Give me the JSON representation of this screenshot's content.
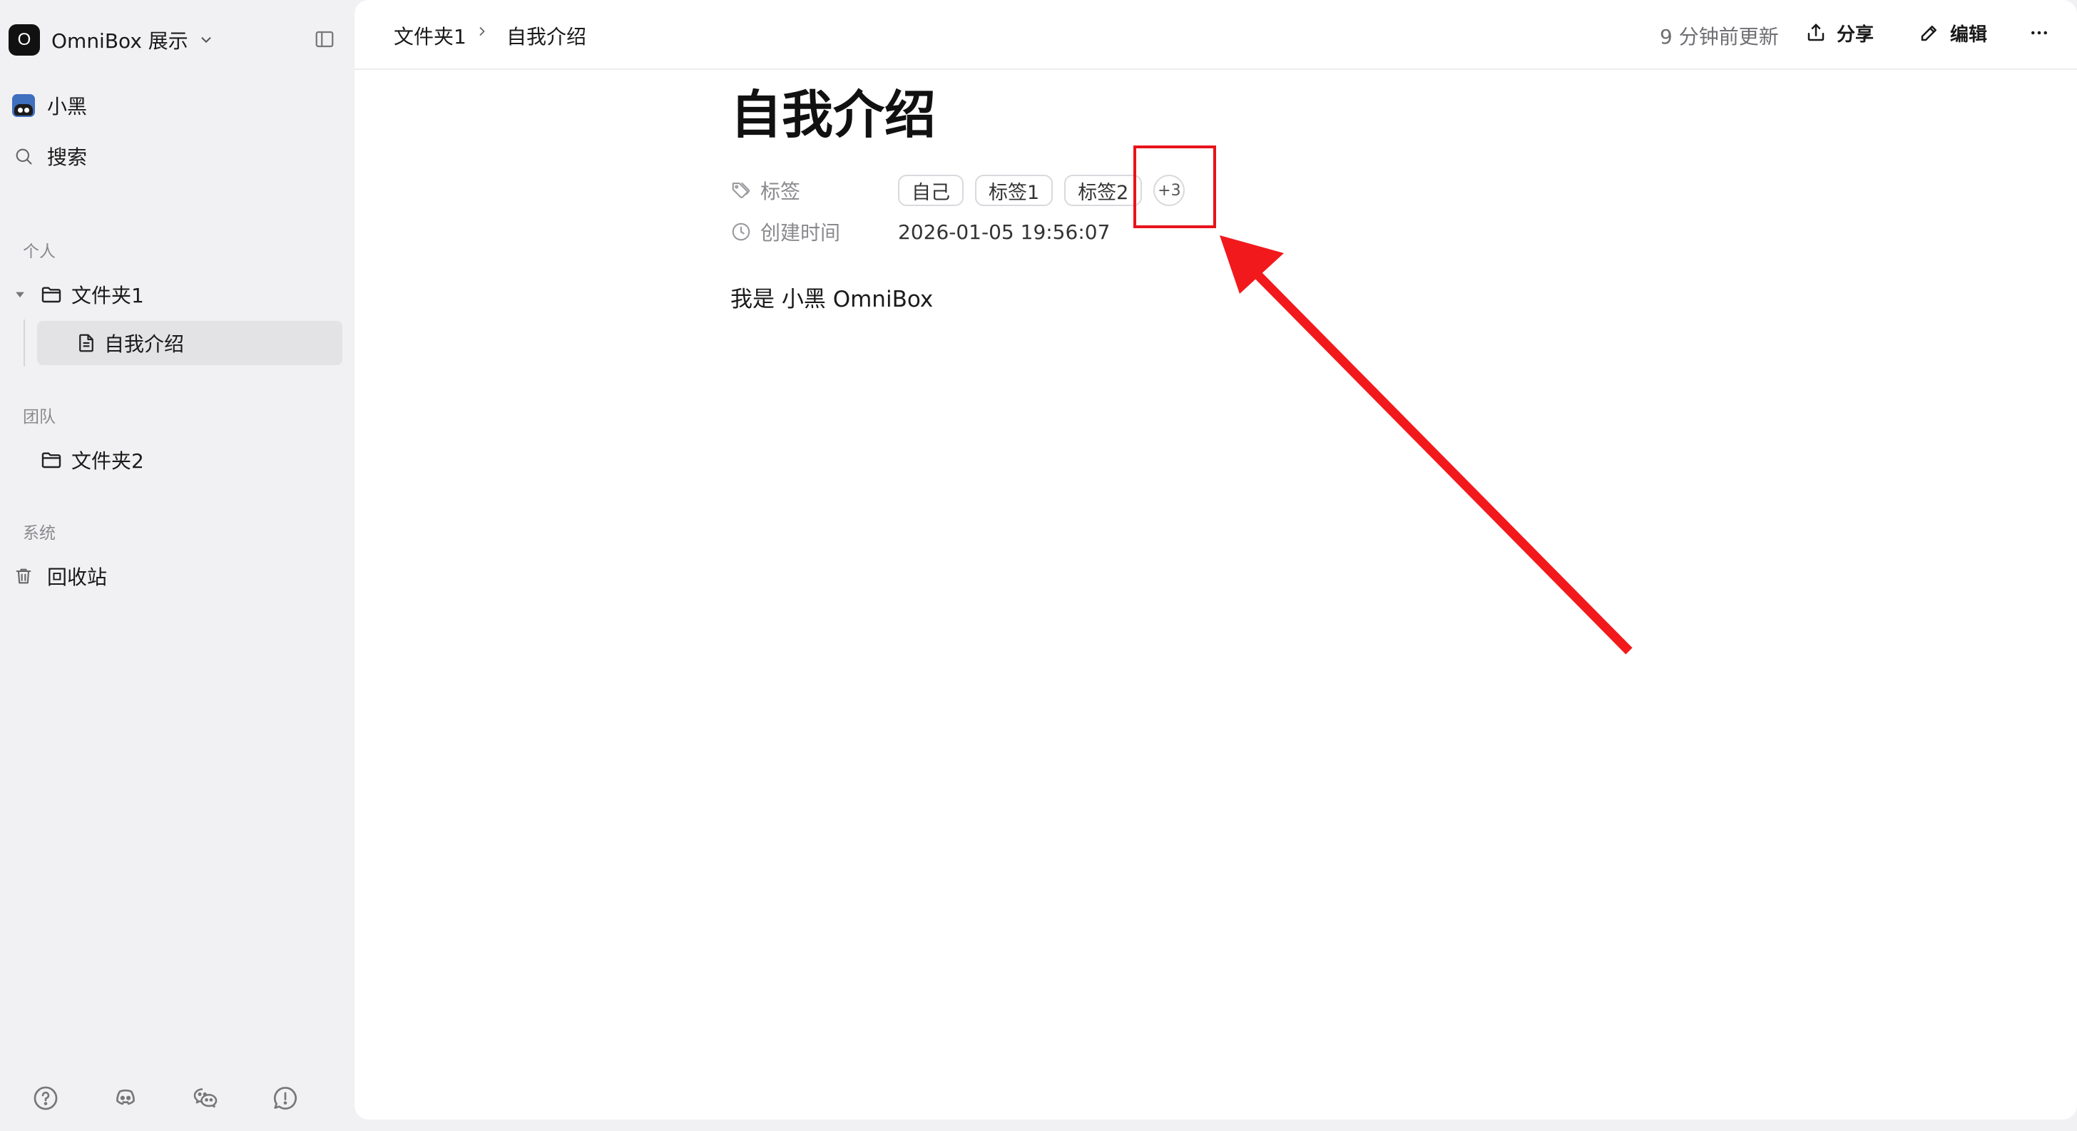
{
  "sidebar": {
    "workspace": {
      "logo_letter": "O",
      "name": "OmniBox 展示"
    },
    "user": {
      "name": "小黑"
    },
    "search": {
      "label": "搜索"
    },
    "sections": {
      "personal": "个人",
      "team": "团队",
      "system": "系统"
    },
    "tree": {
      "folder1": "文件夹1",
      "doc1": "自我介绍",
      "folder2": "文件夹2",
      "trash": "回收站"
    },
    "bottom_icons": [
      "help-icon",
      "discord-icon",
      "wechat-icon",
      "feedback-icon"
    ]
  },
  "topbar": {
    "breadcrumb": [
      "文件夹1",
      "自我介绍"
    ],
    "updated": "9 分钟前更新",
    "share_label": "分享",
    "edit_label": "编辑"
  },
  "doc": {
    "title": "自我介绍",
    "props": {
      "tags_label": "标签",
      "tags": [
        "自己",
        "标签1",
        "标签2"
      ],
      "tags_more": "+3",
      "created_label": "创建时间",
      "created_value": "2026-01-05 19:56:07"
    },
    "body": "我是 小黑 OmniBox"
  },
  "annotation": {
    "color": "#e8131a"
  }
}
